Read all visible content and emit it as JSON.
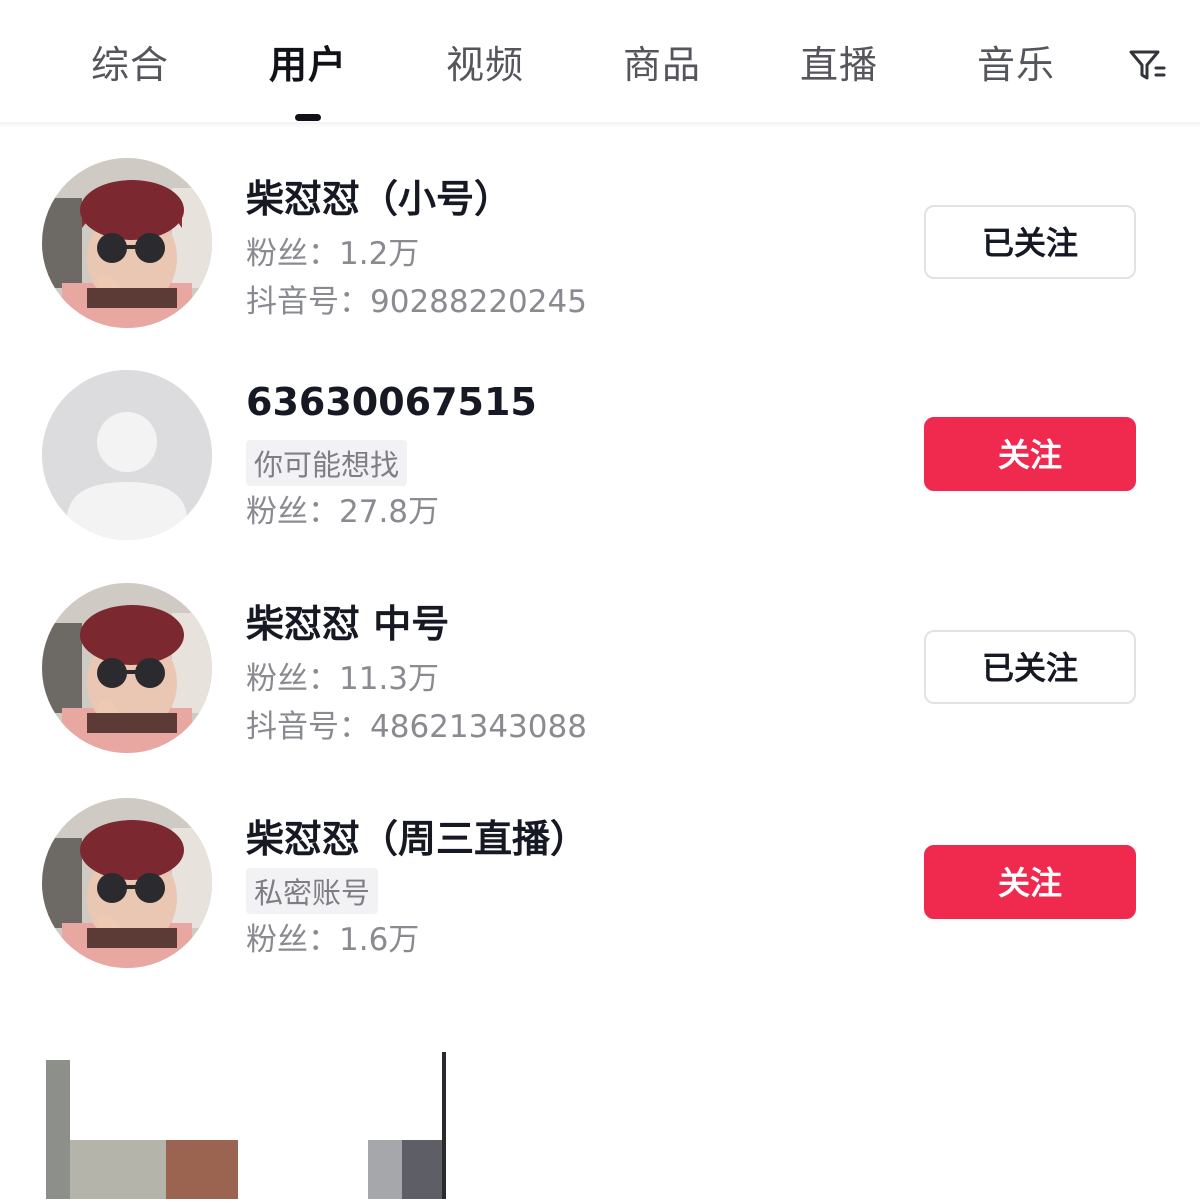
{
  "tabs": [
    {
      "label": "综合",
      "active": false
    },
    {
      "label": "用户",
      "active": true
    },
    {
      "label": "视频",
      "active": false
    },
    {
      "label": "商品",
      "active": false
    },
    {
      "label": "直播",
      "active": false
    },
    {
      "label": "音乐",
      "active": false
    }
  ],
  "filter_icon": "filter-icon",
  "users": [
    {
      "name": "柴怼怼（小号）",
      "fans": "粉丝：1.2万",
      "douyin_id": "抖音号：90288220245",
      "button": "已关注",
      "following": true
    },
    {
      "name": "63630067515",
      "tag": "你可能想找",
      "fans": "粉丝：27.8万",
      "button": "关注",
      "following": false
    },
    {
      "name": "柴怼怼 中号",
      "fans": "粉丝：11.3万",
      "douyin_id": "抖音号：48621343088",
      "button": "已关注",
      "following": true
    },
    {
      "name": "柴怼怼（周三直播）",
      "tag": "私密账号",
      "fans": "粉丝：1.6万",
      "button": "关注",
      "following": false
    }
  ],
  "colors": {
    "accent": "#f0294f",
    "text": "#161823",
    "muted": "#8a8b91"
  }
}
